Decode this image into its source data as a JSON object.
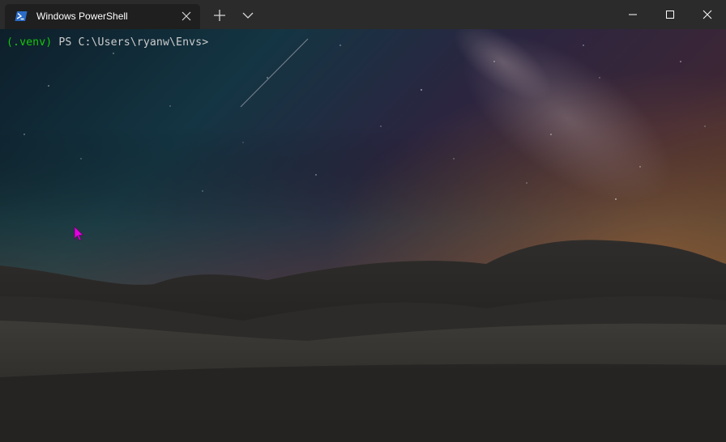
{
  "app": {
    "window_title": "Windows PowerShell"
  },
  "tabs": [
    {
      "title": "Windows PowerShell",
      "icon": "powershell-icon",
      "active": true
    }
  ],
  "tabbar": {
    "new_tab_icon": "plus-icon",
    "dropdown_icon": "chevron-down-icon"
  },
  "caption_buttons": [
    "minimize-icon",
    "maximize-icon",
    "close-icon"
  ],
  "terminal": {
    "venv": "(.venv)",
    "prompt": " PS C:\\Users\\ryanw\\Envs>",
    "background": "night-sky-hills-wallpaper"
  },
  "colors": {
    "titlebar": "#2b2b2b",
    "active_tab": "#1f1f1f",
    "venv_green": "#16c60c",
    "prompt_text": "#cccccc",
    "pointer": "#e300e3"
  }
}
